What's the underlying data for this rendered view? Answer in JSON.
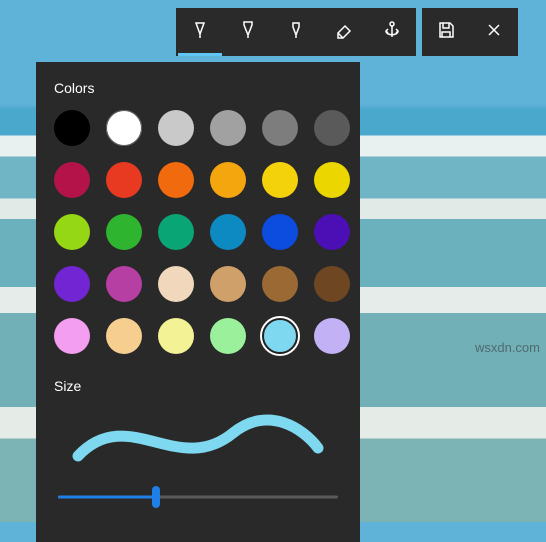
{
  "watermark": "wsxdn.com",
  "toolbar": {
    "tools": [
      {
        "name": "pen-tool",
        "icon": "pen-icon",
        "active": true
      },
      {
        "name": "pencil-tool",
        "icon": "pencil-icon",
        "active": false
      },
      {
        "name": "highlighter-tool",
        "icon": "highlighter-icon",
        "active": false
      },
      {
        "name": "eraser-tool",
        "icon": "eraser-icon",
        "active": false
      },
      {
        "name": "anchor-tool",
        "icon": "anchor-icon",
        "active": false
      }
    ],
    "actions": [
      {
        "name": "save-button",
        "icon": "save-icon"
      },
      {
        "name": "close-button",
        "icon": "close-icon"
      }
    ]
  },
  "panel": {
    "colors_label": "Colors",
    "size_label": "Size",
    "colors": [
      [
        {
          "hex": "#000000",
          "name": "black"
        },
        {
          "hex": "#ffffff",
          "name": "white"
        },
        {
          "hex": "#c9c9c9",
          "name": "light-gray"
        },
        {
          "hex": "#a1a1a1",
          "name": "gray"
        },
        {
          "hex": "#7d7d7d",
          "name": "dark-gray"
        },
        {
          "hex": "#5a5a5a",
          "name": "darker-gray"
        }
      ],
      [
        {
          "hex": "#b31348",
          "name": "dark-red"
        },
        {
          "hex": "#e83a20",
          "name": "red"
        },
        {
          "hex": "#f26a0e",
          "name": "orange"
        },
        {
          "hex": "#f3a60d",
          "name": "amber"
        },
        {
          "hex": "#f3d20b",
          "name": "yellow"
        },
        {
          "hex": "#ebd600",
          "name": "gold"
        }
      ],
      [
        {
          "hex": "#95d615",
          "name": "lime"
        },
        {
          "hex": "#2fb42f",
          "name": "green"
        },
        {
          "hex": "#0aa574",
          "name": "teal"
        },
        {
          "hex": "#0e8ac2",
          "name": "blue"
        },
        {
          "hex": "#0c4de0",
          "name": "royal-blue"
        },
        {
          "hex": "#4b0fb5",
          "name": "indigo"
        }
      ],
      [
        {
          "hex": "#7225d3",
          "name": "purple"
        },
        {
          "hex": "#b53fa2",
          "name": "magenta"
        },
        {
          "hex": "#f1d8bc",
          "name": "beige"
        },
        {
          "hex": "#cfa06a",
          "name": "tan"
        },
        {
          "hex": "#9b6a34",
          "name": "brown"
        },
        {
          "hex": "#6e4621",
          "name": "dark-brown"
        }
      ],
      [
        {
          "hex": "#f49ef2",
          "name": "pink"
        },
        {
          "hex": "#f6cf90",
          "name": "peach"
        },
        {
          "hex": "#f3f396",
          "name": "light-yellow"
        },
        {
          "hex": "#9bf19b",
          "name": "light-green"
        },
        {
          "hex": "#7ed8f0",
          "name": "light-blue",
          "selected": true
        },
        {
          "hex": "#c3b1f5",
          "name": "lavender"
        }
      ]
    ],
    "selected_color": "#7ed8f0",
    "slider": {
      "value": 35,
      "min": 0,
      "max": 100
    }
  }
}
